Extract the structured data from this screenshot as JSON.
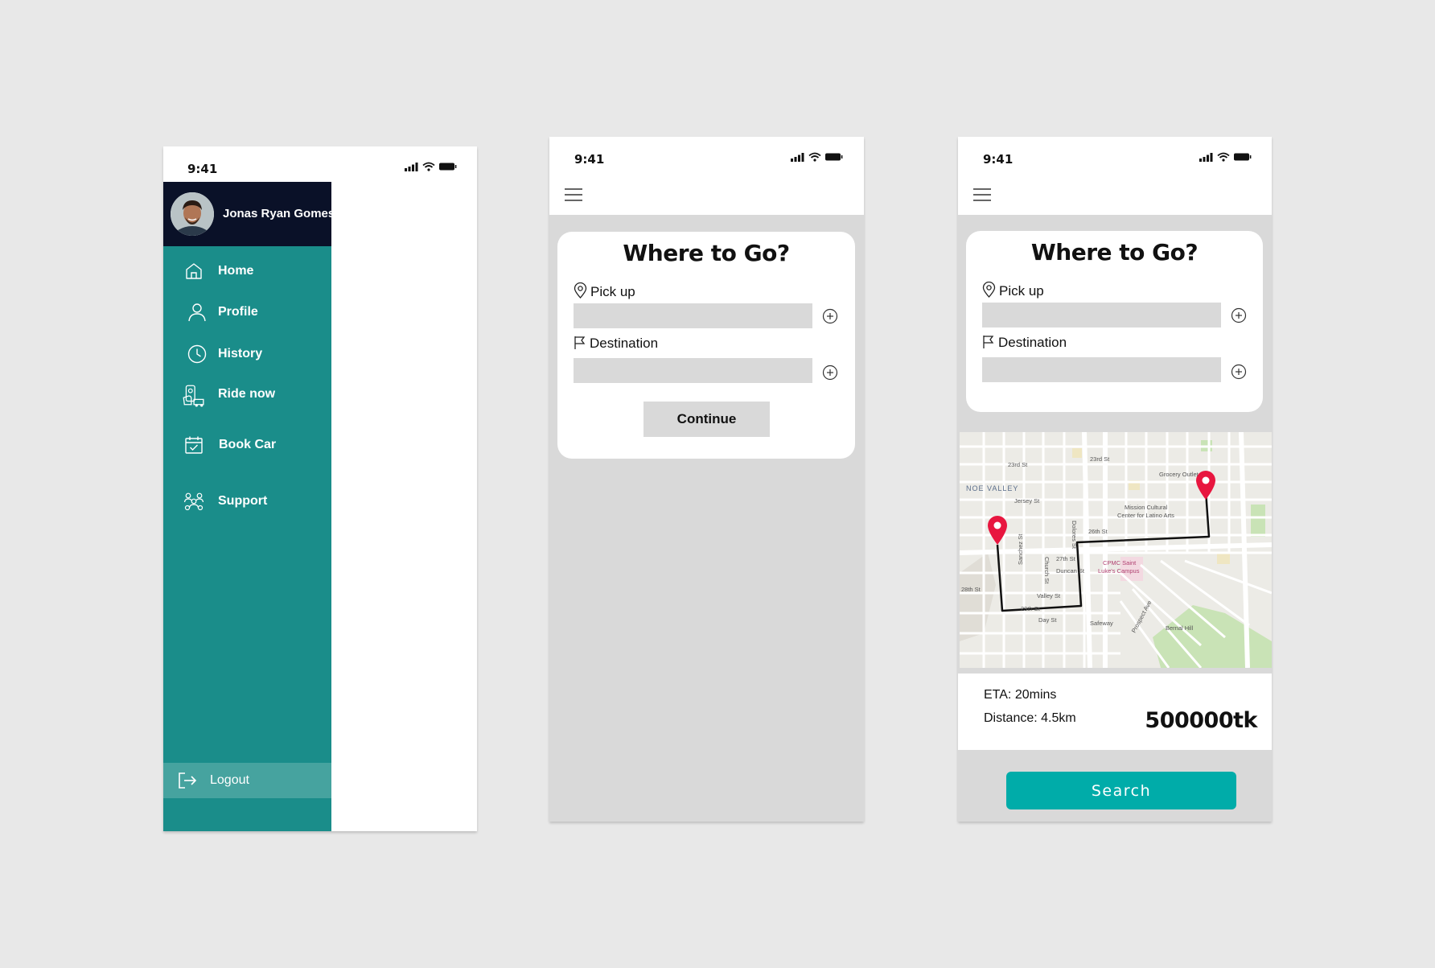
{
  "status": {
    "time": "9:41"
  },
  "drawer": {
    "user_name": "Jonas Ryan Gomes",
    "items": [
      {
        "label": "Home",
        "icon": "home-icon"
      },
      {
        "label": "Profile",
        "icon": "user-icon"
      },
      {
        "label": "History",
        "icon": "clock-icon"
      },
      {
        "label": "Ride now",
        "icon": "ride-icon"
      },
      {
        "label": "Book Car",
        "icon": "calendar-check-icon"
      },
      {
        "label": "Support",
        "icon": "support-icon"
      }
    ],
    "logout_label": "Logout"
  },
  "trip": {
    "title": "Where to Go?",
    "pickup_label": "Pick up",
    "pickup_value": "",
    "destination_label": "Destination",
    "destination_value": "",
    "continue_label": "Continue"
  },
  "result": {
    "eta": "ETA: 20mins",
    "distance": "Distance: 4.5km",
    "price": "500000tk",
    "search_label": "Search"
  },
  "map_labels": {
    "st_23rd_a": "23rd St",
    "st_23rd_b": "23rd St",
    "grocery": "Grocery Outlet",
    "noe_valley": "NOE VALLEY",
    "jersey": "Jersey St",
    "mission_1": "Mission Cultural",
    "mission_2": "Center for Latino Arts",
    "st_26th": "26th St",
    "sanchez": "Sanchez St",
    "church": "Church St",
    "dolores": "Dolores St",
    "st_27th": "27th St",
    "duncan": "Duncan St",
    "cpmc_1": "CPMC Saint",
    "cpmc_2": "Luke's Campus",
    "st_28th": "28th St",
    "valley": "Valley St",
    "st_29th": "29th St",
    "day": "Day St",
    "safeway": "Safeway",
    "prospect": "Prospect Ave",
    "bernal": "Bernal Hill"
  },
  "colors": {
    "teal": "#1a8d8a",
    "navy": "#0a1128",
    "accent": "#00aca9",
    "pin": "#e8163f"
  }
}
